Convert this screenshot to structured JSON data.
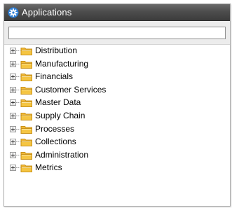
{
  "window": {
    "title": "Applications",
    "title_icon": "gear-icon"
  },
  "search": {
    "value": "",
    "placeholder": ""
  },
  "tree": {
    "items": [
      {
        "label": "Distribution",
        "icon": "folder-icon",
        "expander": "plus"
      },
      {
        "label": "Manufacturing",
        "icon": "folder-icon",
        "expander": "plus"
      },
      {
        "label": "Financials",
        "icon": "folder-icon",
        "expander": "plus"
      },
      {
        "label": "Customer Services",
        "icon": "folder-icon",
        "expander": "plus"
      },
      {
        "label": "Master Data",
        "icon": "folder-icon",
        "expander": "plus"
      },
      {
        "label": "Supply Chain",
        "icon": "folder-icon",
        "expander": "plus"
      },
      {
        "label": "Processes",
        "icon": "folder-icon",
        "expander": "plus"
      },
      {
        "label": "Collections",
        "icon": "folder-icon",
        "expander": "plus"
      },
      {
        "label": "Administration",
        "icon": "folder-icon",
        "expander": "plus"
      },
      {
        "label": "Metrics",
        "icon": "folder-icon",
        "expander": "plus"
      }
    ]
  },
  "colors": {
    "titlebar": "#4d4d4d",
    "folder": "#f5c542",
    "folder_edge": "#c9921a"
  }
}
